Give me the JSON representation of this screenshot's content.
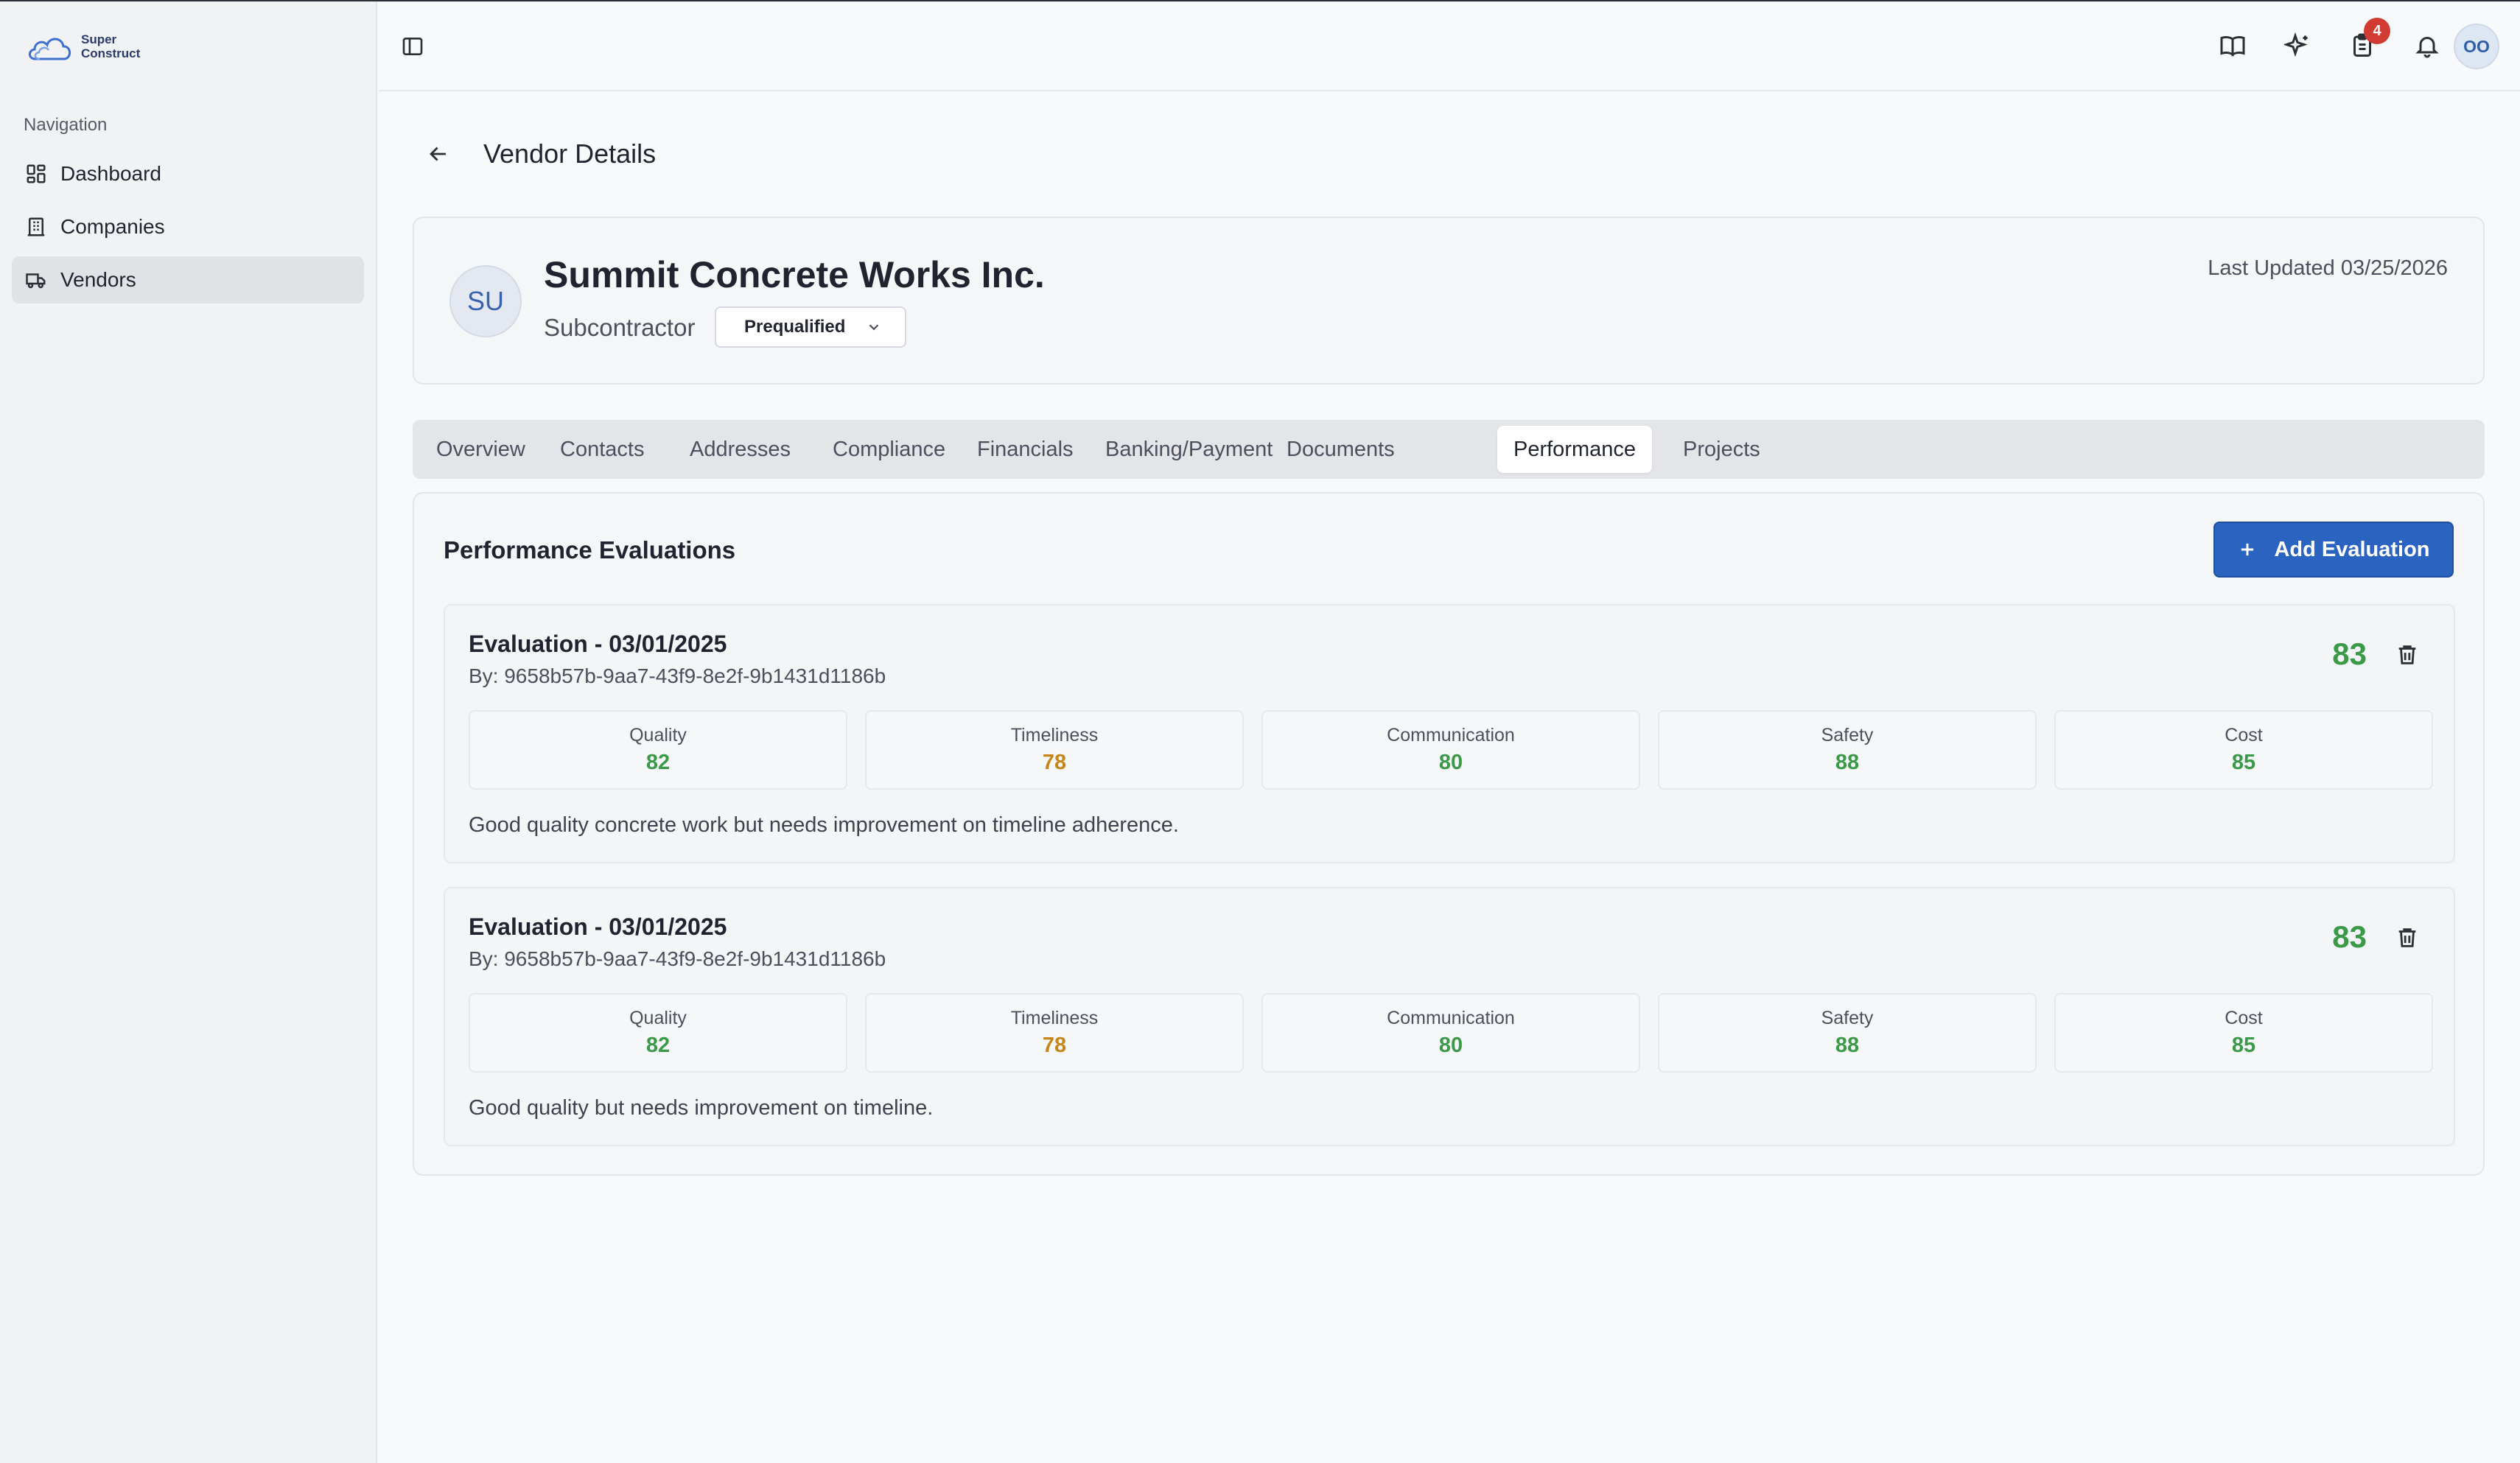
{
  "brand": {
    "line1": "Super",
    "line2": "Construct"
  },
  "sidebar": {
    "heading": "Navigation",
    "items": [
      {
        "label": "Dashboard",
        "icon": "dashboard-icon",
        "active": false
      },
      {
        "label": "Companies",
        "icon": "building-icon",
        "active": false
      },
      {
        "label": "Vendors",
        "icon": "truck-icon",
        "active": true
      }
    ]
  },
  "topbar": {
    "notification_count": "4",
    "user_initials": "OO",
    "icons": [
      "sidebar-toggle-icon",
      "book-icon",
      "sparkles-icon",
      "clipboard-icon",
      "bell-icon"
    ]
  },
  "page": {
    "title": "Vendor Details"
  },
  "vendor": {
    "initials": "SU",
    "name": "Summit Concrete Works Inc.",
    "type": "Subcontractor",
    "status": "Prequalified",
    "last_updated": "Last Updated 03/25/2026"
  },
  "tabs": [
    "Overview",
    "Contacts",
    "Addresses",
    "Compliance",
    "Financials",
    "Banking/Payment",
    "Documents",
    "Performance",
    "Projects"
  ],
  "active_tab": "Performance",
  "performance": {
    "title": "Performance Evaluations",
    "add_label": "Add Evaluation",
    "evaluations": [
      {
        "title": "Evaluation - 03/01/2025",
        "by": "By: 9658b57b-9aa7-43f9-8e2f-9b1431d1186b",
        "score": "83",
        "metrics": [
          {
            "label": "Quality",
            "value": "82",
            "color": "#3b9a48"
          },
          {
            "label": "Timeliness",
            "value": "78",
            "color": "#c7861a"
          },
          {
            "label": "Communication",
            "value": "80",
            "color": "#3b9a48"
          },
          {
            "label": "Safety",
            "value": "88",
            "color": "#3b9a48"
          },
          {
            "label": "Cost",
            "value": "85",
            "color": "#3b9a48"
          }
        ],
        "note": "Good quality concrete work but needs improvement on timeline adherence."
      },
      {
        "title": "Evaluation - 03/01/2025",
        "by": "By: 9658b57b-9aa7-43f9-8e2f-9b1431d1186b",
        "score": "83",
        "metrics": [
          {
            "label": "Quality",
            "value": "82",
            "color": "#3b9a48"
          },
          {
            "label": "Timeliness",
            "value": "78",
            "color": "#c7861a"
          },
          {
            "label": "Communication",
            "value": "80",
            "color": "#3b9a48"
          },
          {
            "label": "Safety",
            "value": "88",
            "color": "#3b9a48"
          },
          {
            "label": "Cost",
            "value": "85",
            "color": "#3b9a48"
          }
        ],
        "note": "Good quality but needs improvement on timeline."
      }
    ]
  },
  "colors": {
    "accent": "#2b63c0",
    "score_good": "#3b9a48",
    "score_warn": "#c7861a",
    "badge": "#d23b34"
  }
}
